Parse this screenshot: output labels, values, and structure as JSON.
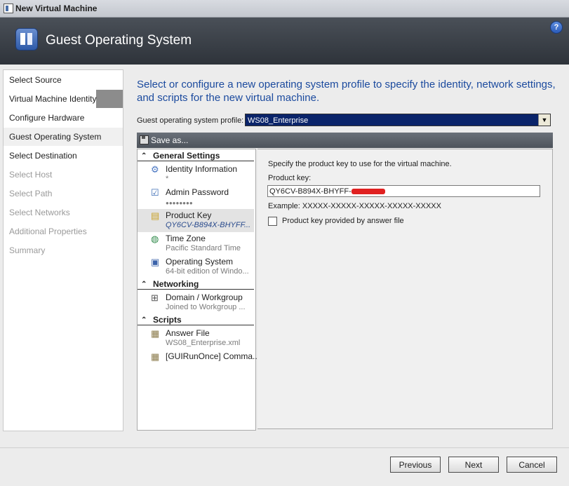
{
  "window": {
    "title": "New Virtual Machine"
  },
  "header": {
    "title": "Guest Operating System",
    "help_icon": "help-icon"
  },
  "nav": {
    "items": [
      {
        "label": "Select Source",
        "state": "active"
      },
      {
        "label": "Virtual Machine Identity",
        "state": "active"
      },
      {
        "label": "Configure Hardware",
        "state": "active"
      },
      {
        "label": "Guest Operating System",
        "state": "current"
      },
      {
        "label": "Select Destination",
        "state": "active"
      },
      {
        "label": "Select Host",
        "state": "disabled"
      },
      {
        "label": "Select Path",
        "state": "disabled"
      },
      {
        "label": "Select Networks",
        "state": "disabled"
      },
      {
        "label": "Additional Properties",
        "state": "disabled"
      },
      {
        "label": "Summary",
        "state": "disabled"
      }
    ]
  },
  "main": {
    "intro": "Select or configure a new operating system profile to specify the identity, network settings, and scripts for the new virtual machine.",
    "profile_label": "Guest operating system profile:",
    "profile_value": "WS08_Enterprise",
    "save_label": "Save as...",
    "groups": {
      "general": "General Settings",
      "networking": "Networking",
      "scripts": "Scripts"
    },
    "tree": {
      "identity": {
        "title": "Identity Information",
        "sub": "*"
      },
      "admin": {
        "title": "Admin Password",
        "sub": "●●●●●●●●"
      },
      "product": {
        "title": "Product Key",
        "sub": "QY6CV-B894X-BHYFF..."
      },
      "timezone": {
        "title": "Time Zone",
        "sub": "Pacific Standard Time"
      },
      "os": {
        "title": "Operating System",
        "sub": "64-bit edition of Windo..."
      },
      "domain": {
        "title": "Domain / Workgroup",
        "sub": "Joined to Workgroup ..."
      },
      "answer": {
        "title": "Answer File",
        "sub": "WS08_Enterprise.xml"
      },
      "guirunonce": {
        "title": "[GUIRunOnce] Comma..."
      }
    },
    "detail": {
      "instruction": "Specify the product key to use for the virtual machine.",
      "key_label": "Product key:",
      "key_value": "QY6CV-B894X-BHYFF-",
      "example": "Example: XXXXX-XXXXX-XXXXX-XXXXX-XXXXX",
      "answer_checkbox": "Product key provided by answer file"
    }
  },
  "buttons": {
    "previous": "Previous",
    "next": "Next",
    "cancel": "Cancel"
  },
  "colors": {
    "intro_blue": "#1b4a9e",
    "header_dark": "#3b4048",
    "select_navy": "#0a246a"
  }
}
